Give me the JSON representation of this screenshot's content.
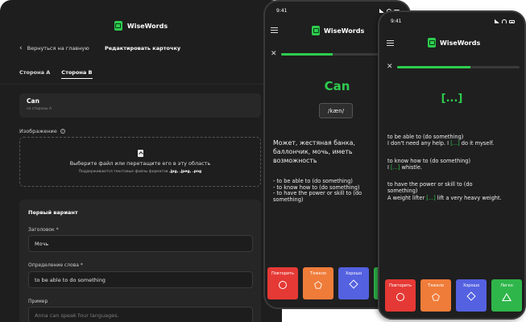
{
  "brand": {
    "name": "WiseWords",
    "accent": "#2ecc4f"
  },
  "tablet": {
    "back_label": "Вернуться на главную",
    "page_title": "Редактировать карточку",
    "tabs": [
      {
        "label": "Сторона А",
        "active": false
      },
      {
        "label": "Сторона В",
        "active": true
      }
    ],
    "card": {
      "value": "Can",
      "subtitle": "со стороны А"
    },
    "image_label": "Изображение",
    "dropzone": {
      "main": "Выберите файл или перетащите его в эту область",
      "sub_prefix": "Поддерживаются текстовые файлы форматов",
      "formats": ".jpg, .jpeg, .png"
    },
    "variant": {
      "title": "Первый вариант",
      "heading_label": "Заголовок *",
      "heading_value": "Мочь",
      "definition_label": "Определение слова *",
      "definition_value": "to be able to do something",
      "example_label": "Пример",
      "example_placeholder": "Anna can speak four languages."
    }
  },
  "phone1": {
    "time": "9:41",
    "progress": 0.4,
    "word": "Can",
    "transcription": "/kæn/",
    "definition": "Может, жестяная банка, баллончик, мочь, иметь возможность",
    "items": [
      "-  to be able to (do something)",
      "-  to know how to (do something)",
      "-  to have the power or skill to (do",
      "something)"
    ],
    "buttons": [
      {
        "label": "Повторить",
        "color": "#e53935",
        "icon": "circle-icon"
      },
      {
        "label": "Тяжело",
        "color": "#f07c3a",
        "icon": "pentagon-icon"
      },
      {
        "label": "Хорошо",
        "color": "#5461e0",
        "icon": "diamond-icon"
      },
      {
        "label": "",
        "color": "#2fb64a",
        "icon": "triangle-icon"
      }
    ]
  },
  "phone2": {
    "time": "9:41",
    "progress": 0.6,
    "word": "[...]",
    "b1_line1": "to be able to (do something)",
    "b1_pre": "I don't need any help. I ",
    "b1_gap": "[...]",
    "b1_post": " do it myself.",
    "b2_line1": "to know how to (do something)",
    "b2_pre": "I ",
    "b2_gap": "[...]",
    "b2_post": " whistle.",
    "b3_line1": "to have the power or skill to (do",
    "b3_line2": "something)",
    "b3_pre": "A weight lifter ",
    "b3_gap": "[...]",
    "b3_post": " lift a very heavy weight.",
    "buttons": [
      {
        "label": "Повторить",
        "color": "#e53935",
        "icon": "circle-icon"
      },
      {
        "label": "Тяжело",
        "color": "#f07c3a",
        "icon": "pentagon-icon"
      },
      {
        "label": "Хорошо",
        "color": "#5461e0",
        "icon": "diamond-icon"
      },
      {
        "label": "Легко",
        "color": "#2fb64a",
        "icon": "triangle-icon"
      }
    ]
  }
}
